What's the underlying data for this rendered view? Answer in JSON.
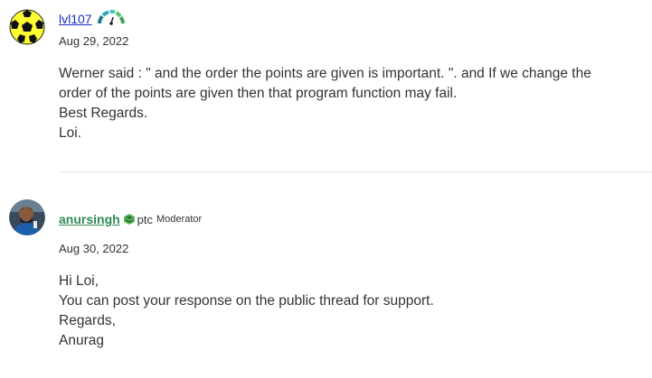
{
  "posts": [
    {
      "author": "lvl107",
      "date": "Aug 29, 2022",
      "avatar_icon": "soccer-ball-icon",
      "rank_icon": "gauge-rank-icon",
      "body": [
        "Werner said : \" and the order the points are given is important. \". and If we change the",
        "order of the points are given then that program function may fail.",
        "Best Regards.",
        "Loi."
      ]
    },
    {
      "author": "anursingh",
      "brand": "ptc",
      "role": "Moderator",
      "date": "Aug 30, 2022",
      "avatar_icon": "user-photo-icon",
      "rank_icon": "ptc-logo-icon",
      "body": [
        "Hi Loi,",
        "You can post your response on the public thread for support.",
        "Regards,",
        "Anurag"
      ]
    }
  ],
  "colors": {
    "author_link_1": "#1a2fbf",
    "author_link_2": "#2e8b57",
    "text": "#333333",
    "divider": "#e3e3e3"
  }
}
